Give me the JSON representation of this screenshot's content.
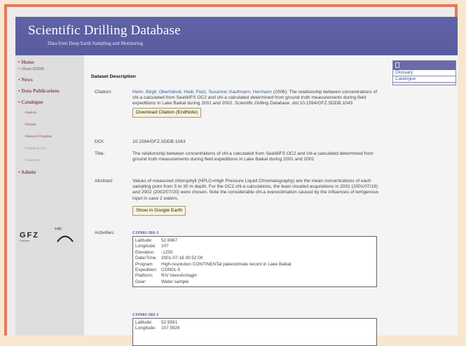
{
  "header": {
    "title": "Scientific Drilling Database",
    "subtitle": "Data from Deep Earth Sampling and Monitoring"
  },
  "sidebar": {
    "items": [
      {
        "label": "• Home",
        "level": 1
      },
      {
        "label": "• About SDDB",
        "level": 1
      },
      {
        "label": "• News",
        "level": 1
      },
      {
        "label": "• Data Publications",
        "level": 1
      },
      {
        "label": "• Catalogue",
        "level": 1
      },
      {
        "label": "• Authors",
        "level": 2
      },
      {
        "label": "• Dataset",
        "level": 2
      },
      {
        "label": "• Research Programs",
        "level": 2
      },
      {
        "label": "• Sampling Gear",
        "level": 2
      },
      {
        "label": "• Parameters",
        "level": 2
      },
      {
        "label": "• Admin",
        "level": 1
      }
    ],
    "logos": {
      "gfz": "GFZ",
      "gfz_sub": "Potsdam",
      "icdp_a": "icdp",
      "icdp_b": "!"
    }
  },
  "right_panel": {
    "links": [
      "Glossary",
      "Catalogue"
    ]
  },
  "dataset": {
    "section_title": "Dataset Description",
    "labels": {
      "citation": "Citation:",
      "doi": "DOI:",
      "title": "Title:",
      "abstract": "Abstract:",
      "activities": "Activities:"
    },
    "citation_authors": "Heim, Birgit; Oberhänsli, Hedi; Fietz, Susanne; Kaufmann, Hermann",
    "citation_rest": " (2006): The relationship between concentrations of chl-a calculated from SeaWiFS OC2 and chl-a calculated determined from ground truth measurements during field expeditions in Lake Baikal during 2001 and 2002. ",
    "citation_journal": "Scientific Drilling Database",
    "citation_doi": ". doi:10.1594/GFZ.SDDB.1043",
    "download_button": "Download Citation (EndNote)",
    "doi": "10.1594/GFZ.SDDB.1043",
    "title": "The relationship between concentrations of chl-a calculated from SeaWiFS OC2 and chl-a calculated determined from ground truth measurements during field expeditions in Lake Baikal during 2001 and 2002",
    "abstract": "Values of measured chlorophyll (HPLC=High Pressure Liquid Chromatography) are the mean concentrations of each sampling point from 5 to 30 m depth. For the OC2 chl-a calculations, the least clouded acquisitions in 2001 (2001/07/19) and 2002 (2002/07/20) were chosen. Note the considerable chl-a overestimation caused by the influences of terrigenous input in case 2 waters.",
    "google_earth_button": "Show in Google Earth"
  },
  "activities": [
    {
      "code": "CON01-501-1",
      "rows": [
        {
          "k": "Latitude:",
          "v": "52.6667"
        },
        {
          "k": "Longitude:",
          "v": "107"
        },
        {
          "k": "Elevation:",
          "v": "-1250"
        },
        {
          "k": "Date/Time:",
          "v": "2001-07-16 00:52:00"
        },
        {
          "k": "Program:",
          "v": "High-resolution CONTINENTal paleoclimate record in Lake Baikal"
        },
        {
          "k": "Expedition:",
          "v": "CON01-5"
        },
        {
          "k": "Platform:",
          "v": "R/V Vereshchagin"
        },
        {
          "k": "Gear:",
          "v": "Water sample"
        }
      ]
    },
    {
      "code": "CON01-502-1",
      "rows": [
        {
          "k": "Latitude:",
          "v": "52.9561"
        },
        {
          "k": "Longitude:",
          "v": "107.5926"
        }
      ]
    }
  ]
}
